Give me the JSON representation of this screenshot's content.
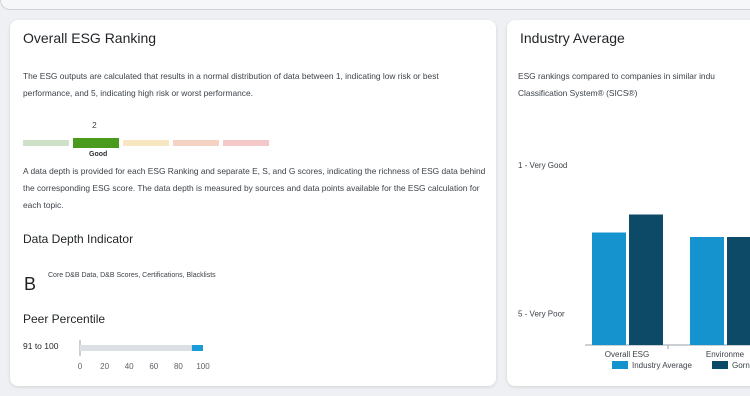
{
  "left_card": {
    "title": "Overall ESG Ranking",
    "intro": "The ESG outputs are calculated that results in a normal distribution of data between 1, indicating low risk or best performance, and 5, indicating high risk or worst performance.",
    "ranking": {
      "value": "2",
      "label": "Good",
      "segment_colors": [
        "#cfe0c9",
        "#4a9a1e",
        "#f6e7c1",
        "#f4d3c4",
        "#f4c8c8"
      ],
      "active_index": 1
    },
    "depth_paragraph": "A data depth is provided for each ESG Ranking and separate E, S, and G scores, indicating the richness of ESG data behind the corresponding ESG score. The data depth is measured by sources and data points available for the ESG calculation for each topic.",
    "data_depth": {
      "title": "Data Depth Indicator",
      "letter": "B",
      "description": "Core D&B Data, D&B Scores, Certifications, Blacklists"
    },
    "peer_percentile": {
      "title": "Peer Percentile",
      "value": "91 to 100",
      "ticks": [
        "0",
        "20",
        "40",
        "60",
        "80",
        "100"
      ],
      "range_start": 91,
      "range_end": 100,
      "bar_color": "#1a9ad6"
    }
  },
  "right_card": {
    "title": "Industry Average",
    "paragraph": "ESG rankings compared to companies in similar indu Classification System® (SICS®)"
  },
  "chart_data": {
    "type": "bar",
    "categories": [
      "Overall ESG",
      "Environme"
    ],
    "y_tick_labels": [
      "1 - Very Good",
      "5 - Very Poor"
    ],
    "ylim": [
      5,
      1
    ],
    "series": [
      {
        "name": "Industry Average",
        "color": "#1493cf",
        "values": [
          2.5,
          2.6
        ]
      },
      {
        "name": "Gorn",
        "color": "#0c4a68",
        "values": [
          2.1,
          2.6
        ]
      }
    ],
    "legend_position": "bottom"
  }
}
